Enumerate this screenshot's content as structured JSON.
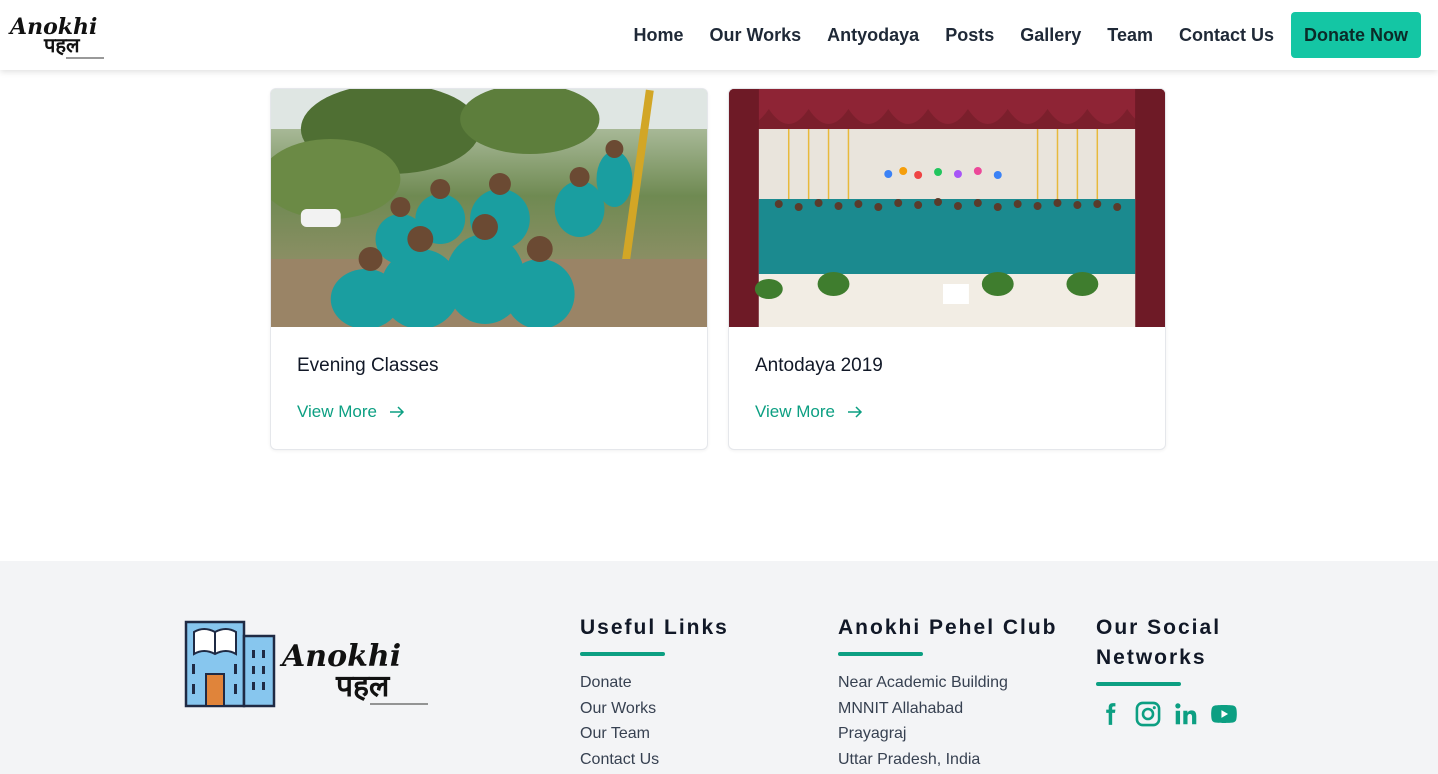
{
  "header": {
    "logo_text_top": "Anokhi",
    "logo_text_bottom": "पहल",
    "nav": [
      {
        "label": "Home"
      },
      {
        "label": "Our Works"
      },
      {
        "label": "Antyodaya"
      },
      {
        "label": "Posts"
      },
      {
        "label": "Gallery"
      },
      {
        "label": "Team"
      },
      {
        "label": "Contact Us"
      }
    ],
    "donate_label": "Donate Now"
  },
  "cards": [
    {
      "title": "Evening Classes",
      "link_label": "View More",
      "image_icon": "group-photo-outdoor"
    },
    {
      "title": "Antodaya 2019",
      "link_label": "View More",
      "image_icon": "group-photo-stage"
    }
  ],
  "footer": {
    "logo_text_top": "Anokhi",
    "logo_text_bottom": "पहल",
    "useful_links": {
      "heading": "Useful Links",
      "items": [
        "Donate",
        "Our Works",
        "Our Team",
        "Contact Us"
      ]
    },
    "club": {
      "heading": "Anokhi Pehel Club",
      "lines": [
        "Near Academic Building",
        "MNNIT Allahabad",
        "Prayagraj",
        "Uttar Pradesh, India"
      ]
    },
    "social": {
      "heading_line1": "Our Social",
      "heading_line2": "Networks",
      "icons": [
        "facebook-icon",
        "instagram-icon",
        "linkedin-icon",
        "youtube-icon"
      ]
    }
  },
  "colors": {
    "accent": "#0c9f82",
    "donate_bg": "#14c6a4",
    "footer_bg": "#f3f4f6"
  }
}
